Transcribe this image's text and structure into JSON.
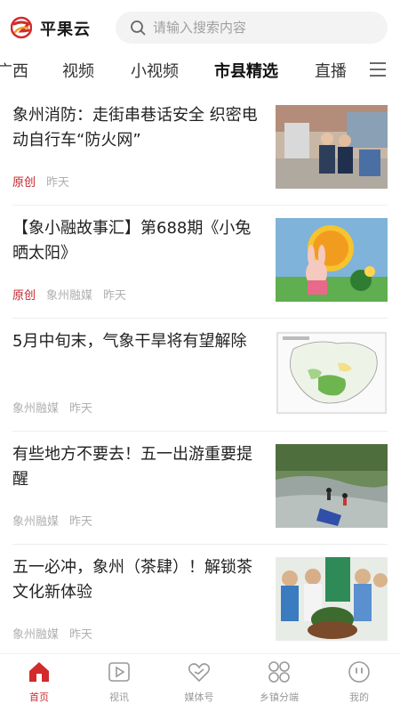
{
  "header": {
    "app_name": "平果云",
    "search_placeholder": "请输入搜索内容"
  },
  "tabs": [
    {
      "label": "广西",
      "active": false
    },
    {
      "label": "视频",
      "active": false
    },
    {
      "label": "小视频",
      "active": false
    },
    {
      "label": "市县精选",
      "active": true
    },
    {
      "label": "直播",
      "active": false
    }
  ],
  "feed": [
    {
      "title": "象州消防：走街串巷话安全 织密电动自行车“防火网”",
      "tag": "原创",
      "source": "",
      "time": "昨天",
      "thumb": "fire-officers-photo"
    },
    {
      "title": "【象小融故事汇】第688期《小兔晒太阳》",
      "tag": "原创",
      "source": "象州融媒",
      "time": "昨天",
      "thumb": "rabbit-sun-painting"
    },
    {
      "title": "5月中旬末，气象干旱将有望解除",
      "tag": "",
      "source": "象州融媒",
      "time": "昨天",
      "thumb": "weather-map"
    },
    {
      "title": "有些地方不要去！五一出游重要提醒",
      "tag": "",
      "source": "象州融媒",
      "time": "昨天",
      "thumb": "river-rescue-photo"
    },
    {
      "title": "五一必冲，象州（茶肆）！解锁茶文化新体验",
      "tag": "",
      "source": "象州融媒",
      "time": "昨天",
      "thumb": "tea-culture-photo"
    }
  ],
  "bottom_nav": [
    {
      "label": "首页",
      "icon": "home-icon",
      "active": true
    },
    {
      "label": "视讯",
      "icon": "video-icon",
      "active": false
    },
    {
      "label": "媒体号",
      "icon": "heart-icon",
      "active": false
    },
    {
      "label": "乡镇分端",
      "icon": "grid-icon",
      "active": false
    },
    {
      "label": "我的",
      "icon": "profile-icon",
      "active": false
    }
  ],
  "colors": {
    "accent": "#d22b2b",
    "original_tag": "#c2272d"
  }
}
